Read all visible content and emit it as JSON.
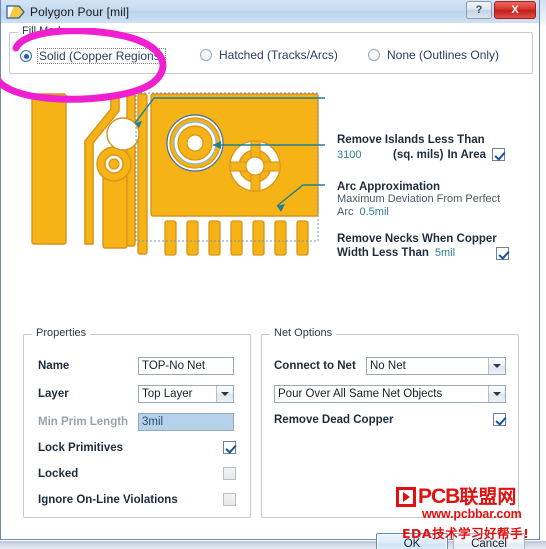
{
  "window": {
    "title": "Polygon Pour [mil]",
    "icon": "polygon-pour-icon",
    "help_label": "?",
    "close_label": "X"
  },
  "fill_mode": {
    "legend": "Fill Mode",
    "options": [
      {
        "label": "Solid (Copper Regions)",
        "selected": true
      },
      {
        "label": "Hatched (Tracks/Arcs)",
        "selected": false
      },
      {
        "label": "None (Outlines Only)",
        "selected": false
      }
    ]
  },
  "annotations": {
    "remove_islands": {
      "heading": "Remove Islands Less Than",
      "value": "3100",
      "units": "(sq. mils)",
      "suffix": "In Area",
      "checked": true
    },
    "arc_approximation": {
      "heading": "Arc Approximation",
      "description": "Maximum Deviation From Perfect",
      "label": "Arc",
      "value": "0.5mil"
    },
    "remove_necks": {
      "heading": "Remove Necks When Copper",
      "label": "Width Less Than",
      "value": "5mil",
      "checked": true
    }
  },
  "properties": {
    "legend": "Properties",
    "name_label": "Name",
    "name_value": "TOP-No Net",
    "layer_label": "Layer",
    "layer_value": "Top Layer",
    "min_prim_label": "Min Prim Length",
    "min_prim_value": "3mil",
    "lock_primitives_label": "Lock Primitives",
    "lock_primitives_checked": true,
    "locked_label": "Locked",
    "locked_checked": false,
    "ignore_violations_label": "Ignore On-Line Violations",
    "ignore_violations_checked": false
  },
  "net_options": {
    "legend": "Net Options",
    "connect_label": "Connect to Net",
    "connect_value": "No Net",
    "pour_over_value": "Pour Over All Same Net Objects",
    "remove_dead_copper_label": "Remove Dead Copper",
    "remove_dead_copper_checked": true
  },
  "buttons": {
    "ok": "OK",
    "cancel": "Cancel"
  },
  "watermark": {
    "brand_latin": "PCB",
    "brand_cn": "联盟网",
    "url": "www.pcbbar.com",
    "tagline": "EDA技术学习好帮手!"
  },
  "colors": {
    "copper": "#f5b316",
    "copper_edge": "#d9941a",
    "accent_blue": "#2e7f95",
    "leader_line": "#1f7f95",
    "magenta_marker": "#f020d0",
    "watermark_red": "#e2100f",
    "title_gradient_top": "#d3e3f5",
    "disabled_field": "#b6d2ea"
  }
}
